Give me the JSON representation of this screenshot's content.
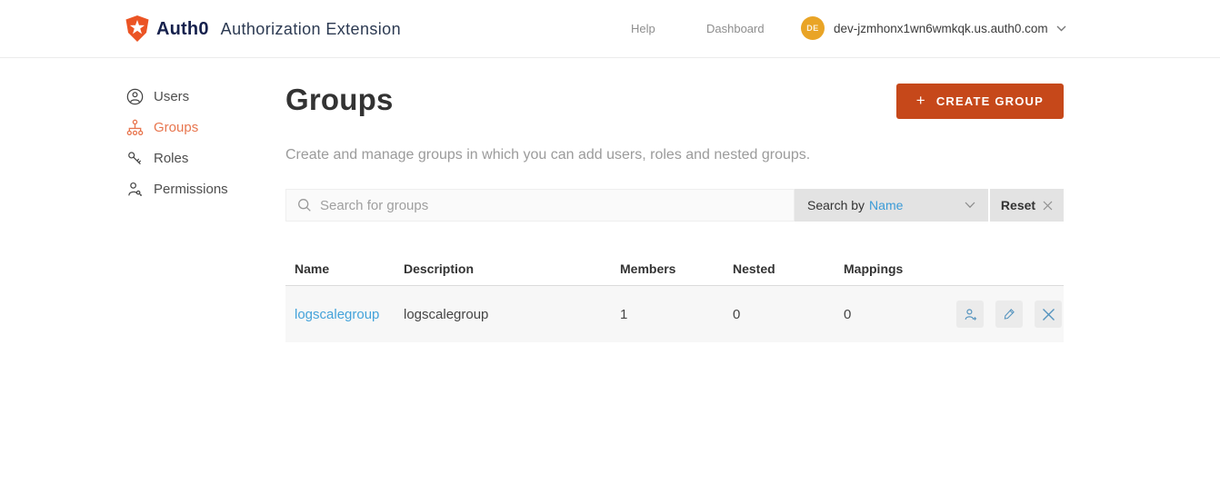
{
  "header": {
    "brand": "Auth0",
    "app_title": "Authorization Extension",
    "nav": [
      {
        "label": "Help"
      },
      {
        "label": "Dashboard"
      }
    ],
    "avatar_initials": "DE",
    "tenant_domain": "dev-jzmhonx1wn6wmkqk.us.auth0.com"
  },
  "sidebar": {
    "items": [
      {
        "label": "Users",
        "icon": "user-icon",
        "active": false
      },
      {
        "label": "Groups",
        "icon": "groups-icon",
        "active": true
      },
      {
        "label": "Roles",
        "icon": "roles-icon",
        "active": false
      },
      {
        "label": "Permissions",
        "icon": "permissions-icon",
        "active": false
      }
    ]
  },
  "main": {
    "title": "Groups",
    "create_button_label": "CREATE GROUP",
    "description": "Create and manage groups in which you can add users, roles and nested groups.",
    "search": {
      "placeholder": "Search for groups",
      "search_by_label": "Search by",
      "search_by_value": "Name",
      "reset_label": "Reset"
    },
    "table": {
      "columns": [
        "Name",
        "Description",
        "Members",
        "Nested",
        "Mappings"
      ],
      "rows": [
        {
          "name": "logscalegroup",
          "description": "logscalegroup",
          "members": "1",
          "nested": "0",
          "mappings": "0"
        }
      ]
    }
  },
  "colors": {
    "brand_orange": "#EB5424",
    "button_orange": "#C6481A",
    "sidebar_active_orange": "#E8764F",
    "link_blue": "#44A3DA",
    "avatar_amber": "#E9A426",
    "row_gray": "#F7F7F7",
    "bar_gray": "#E3E3E3"
  }
}
